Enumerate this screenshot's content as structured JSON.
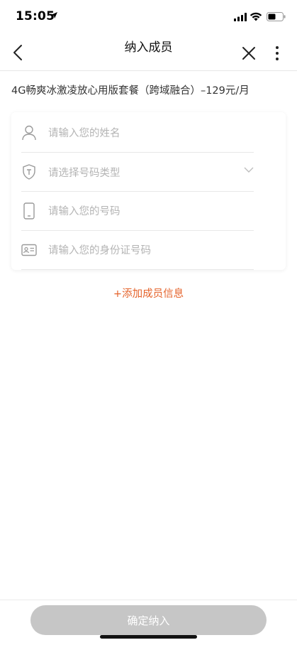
{
  "status_bar": {
    "time": "15:05"
  },
  "nav": {
    "title": "纳入成员"
  },
  "package": {
    "title": "4G畅爽冰激凌放心用版套餐（跨域融合）–129元/月"
  },
  "form": {
    "name_placeholder": "请输入您的姓名",
    "number_type_placeholder": "请选择号码类型",
    "phone_placeholder": "请输入您的号码",
    "id_placeholder": "请输入您的身份证号码"
  },
  "add_member_label": "+添加成员信息",
  "confirm_label": "确定纳入",
  "colors": {
    "accent": "#e5632b",
    "button_disabled": "#c6c6c6"
  },
  "icons": [
    "location-arrow-icon",
    "signal-icon",
    "wifi-icon",
    "battery-icon",
    "back-icon",
    "close-icon",
    "more-icon",
    "user-icon",
    "shield-t-icon",
    "chevron-down-icon",
    "phone-icon",
    "id-card-icon"
  ]
}
